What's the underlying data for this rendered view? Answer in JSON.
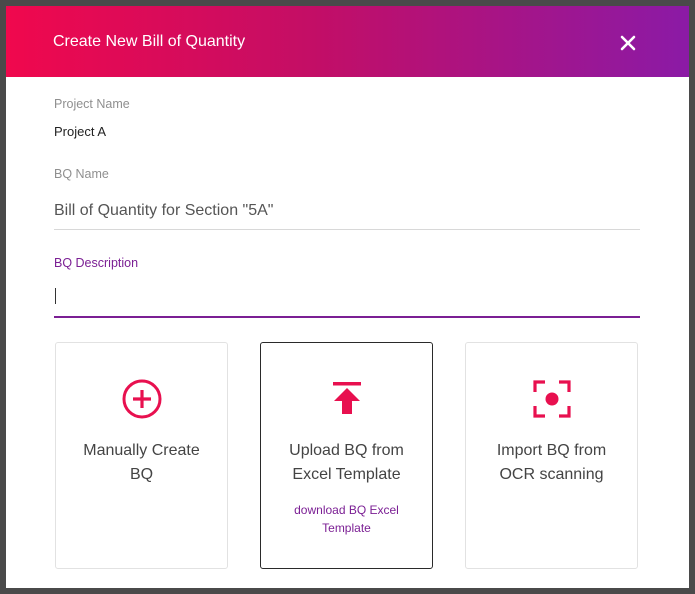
{
  "dialog": {
    "title": "Create New Bill of Quantity"
  },
  "project": {
    "label": "Project Name",
    "value": "Project A"
  },
  "bq_name": {
    "label": "BQ Name",
    "value": "Bill of Quantity for Section \"5A\""
  },
  "bq_description": {
    "label": "BQ Description",
    "value": ""
  },
  "options": [
    {
      "label": "Manually Create BQ",
      "icon": "add-circle-icon"
    },
    {
      "label": "Upload BQ from Excel Template",
      "icon": "upload-icon",
      "link": "download BQ Excel Template"
    },
    {
      "label": "Import BQ from OCR scanning",
      "icon": "scan-icon"
    }
  ],
  "colors": {
    "accent": "#e8104f",
    "purple": "#7b1f94",
    "header_start": "#f0084d",
    "header_end": "#8b1aa6"
  }
}
